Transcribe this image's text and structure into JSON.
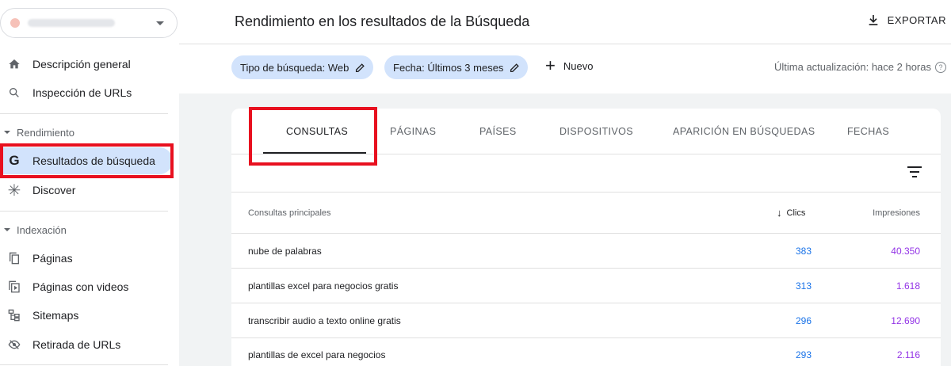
{
  "sidebar": {
    "nav_top": [
      {
        "label": "Descripción general",
        "icon": "home-icon"
      },
      {
        "label": "Inspección de URLs",
        "icon": "search-icon"
      }
    ],
    "sections": [
      {
        "label": "Rendimiento",
        "items": [
          {
            "label": "Resultados de búsqueda",
            "icon": "google-g-icon",
            "active": true
          },
          {
            "label": "Discover",
            "icon": "asterisk-icon"
          }
        ]
      },
      {
        "label": "Indexación",
        "items": [
          {
            "label": "Páginas",
            "icon": "pages-icon"
          },
          {
            "label": "Páginas con videos",
            "icon": "video-page-icon"
          },
          {
            "label": "Sitemaps",
            "icon": "sitemap-icon"
          },
          {
            "label": "Retirada de URLs",
            "icon": "eye-off-icon"
          }
        ]
      }
    ]
  },
  "header": {
    "title": "Rendimiento en los resultados de la Búsqueda",
    "export_label": "EXPORTAR"
  },
  "filters": {
    "chips": [
      {
        "label": "Tipo de búsqueda: Web"
      },
      {
        "label": "Fecha: Últimos 3 meses"
      }
    ],
    "new_label": "Nuevo",
    "updated": "Última actualización: hace 2 horas"
  },
  "tabs": [
    {
      "label": "CONSULTAS",
      "active": true
    },
    {
      "label": "PÁGINAS"
    },
    {
      "label": "PAÍSES"
    },
    {
      "label": "DISPOSITIVOS"
    },
    {
      "label": "APARICIÓN EN BÚSQUEDAS"
    },
    {
      "label": "FECHAS"
    }
  ],
  "table": {
    "headers": {
      "query": "Consultas principales",
      "clicks": "Clics",
      "impressions": "Impresiones"
    },
    "rows": [
      {
        "query": "nube de palabras",
        "clicks": "383",
        "impressions": "40.350"
      },
      {
        "query": "plantillas excel para negocios gratis",
        "clicks": "313",
        "impressions": "1.618"
      },
      {
        "query": "transcribir audio a texto online gratis",
        "clicks": "296",
        "impressions": "12.690"
      },
      {
        "query": "plantillas de excel para negocios",
        "clicks": "293",
        "impressions": "2.116"
      }
    ]
  },
  "colors": {
    "clicks": "#1a73e8",
    "impressions": "#9334e6",
    "chip": "#d2e3fc",
    "highlight": "#e8101f"
  }
}
